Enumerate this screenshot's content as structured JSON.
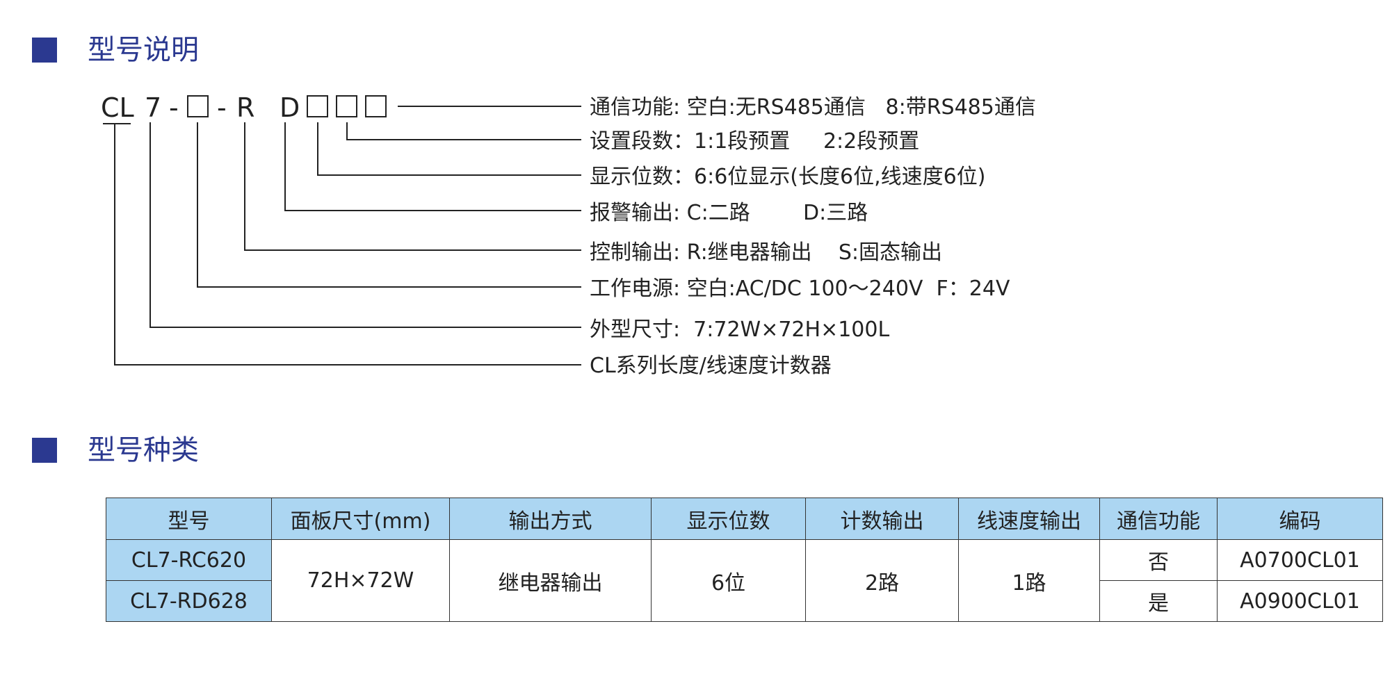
{
  "sections": {
    "model_description_title": "型号说明",
    "model_types_title": "型号种类"
  },
  "code": {
    "series": "CL",
    "size": "7",
    "dash1": "-",
    "dash2": "-",
    "control": "R",
    "alarm": "D"
  },
  "descriptions": [
    "通信功能: 空白:无RS485通信   8:带RS485通信",
    "设置段数：1:1段预置     2:2段预置",
    "显示位数：6:6位显示(长度6位,线速度6位)",
    "报警输出: C:二路        D:三路",
    "控制输出: R:继电器输出    S:固态输出",
    "工作电源: 空白:AC/DC 100～240V  F：24V",
    "外型尺寸:  7:72W×72H×100L",
    "CL系列长度/线速度计数器"
  ],
  "table": {
    "headers": [
      "型号",
      "面板尺寸(mm)",
      "输出方式",
      "显示位数",
      "计数输出",
      "线速度输出",
      "通信功能",
      "编码"
    ],
    "rows": [
      {
        "model": "CL7-RC620",
        "comm": "否",
        "code": "A0700CL01"
      },
      {
        "model": "CL7-RD628",
        "comm": "是",
        "code": "A0900CL01"
      }
    ],
    "shared": {
      "panel_size": "72H×72W",
      "output": "继电器输出",
      "display_digits": "6位",
      "count_output": "2路",
      "speed_output": "1路"
    }
  }
}
